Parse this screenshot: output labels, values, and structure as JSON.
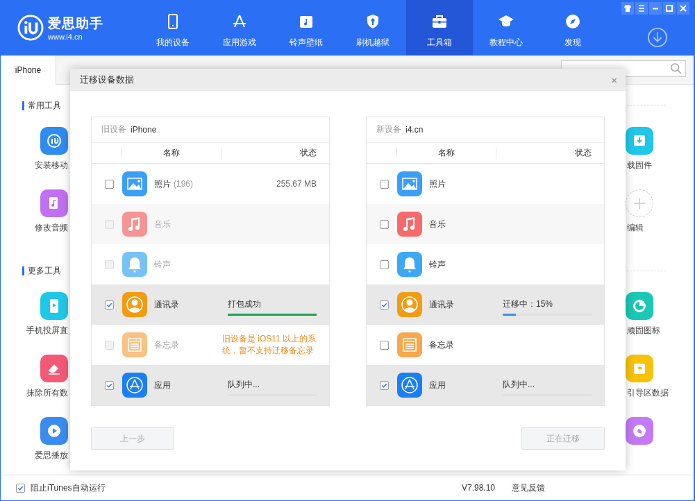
{
  "header": {
    "logo_name": "爱思助手",
    "logo_url": "www.i4.cn",
    "nav": [
      {
        "label": "我的设备",
        "selected": false
      },
      {
        "label": "应用游戏",
        "selected": false
      },
      {
        "label": "铃声壁纸",
        "selected": false
      },
      {
        "label": "刷机越狱",
        "selected": false
      },
      {
        "label": "工具箱",
        "selected": true
      },
      {
        "label": "教程中心",
        "selected": false
      },
      {
        "label": "发现",
        "selected": false
      }
    ]
  },
  "tabs": [
    {
      "label": "iPhone",
      "selected": true
    }
  ],
  "tools_left": {
    "sections": [
      {
        "title": "常用工具",
        "items": [
          {
            "label": "安装移动"
          },
          {
            "label": "修改音频"
          }
        ]
      },
      {
        "title": "更多工具",
        "items": [
          {
            "label": "手机投屏直"
          },
          {
            "label": "抹除所有数"
          },
          {
            "label": "爱思播放"
          }
        ]
      }
    ]
  },
  "tools_right": {
    "sections": [
      {
        "items": [
          {
            "label": "载固件"
          },
          {
            "label": "编辑"
          }
        ]
      },
      {
        "items": [
          {
            "label": "顽固图标"
          },
          {
            "label": "引导区数据"
          }
        ]
      }
    ]
  },
  "dialog": {
    "title": "迁移设备数据",
    "close": "×",
    "panels": [
      {
        "label": "旧设备",
        "device": "iPhone",
        "columns": [
          "名称",
          "状态"
        ],
        "rows": [
          {
            "name": "照片",
            "count": "(196)",
            "size": "255.67 MB",
            "checked": false,
            "disabled": false
          },
          {
            "name": "音乐",
            "checked": false,
            "disabled": true
          },
          {
            "name": "铃声",
            "checked": false,
            "disabled": true
          },
          {
            "name": "通讯录",
            "checked": true,
            "disabled": false,
            "status": {
              "kind": "done",
              "text": "打包成功",
              "level": 1
            }
          },
          {
            "name": "备忘录",
            "checked": false,
            "disabled": true,
            "note": "旧设备是 iOS11 以上的系统，暂不支持迁移备忘录"
          },
          {
            "name": "应用",
            "checked": true,
            "disabled": false,
            "status": {
              "kind": "queued",
              "text": "队列中...",
              "level": 0
            }
          }
        ]
      },
      {
        "label": "新设备",
        "device": "i4.cn",
        "columns": [
          "名称",
          "状态"
        ],
        "rows": [
          {
            "name": "照片",
            "checked": false,
            "disabled": false
          },
          {
            "name": "音乐",
            "checked": false,
            "disabled": false
          },
          {
            "name": "铃声",
            "checked": false,
            "disabled": false
          },
          {
            "name": "通讯录",
            "checked": true,
            "disabled": false,
            "status": {
              "kind": "running",
              "text": "迁移中：15%",
              "level": 0.15
            }
          },
          {
            "name": "备忘录",
            "checked": false,
            "disabled": false
          },
          {
            "name": "应用",
            "checked": true,
            "disabled": false,
            "status": {
              "kind": "queued",
              "text": "队列中...",
              "level": 0
            }
          }
        ]
      }
    ],
    "buttons": [
      {
        "label": "上一步",
        "disabled": true
      },
      {
        "label": "正在迁移",
        "disabled": true
      }
    ]
  },
  "status_bar": {
    "itunes": {
      "label": "阻止iTunes自动运行",
      "checked": true
    },
    "version": "V7.98.10",
    "feedback": "意见反馈"
  }
}
